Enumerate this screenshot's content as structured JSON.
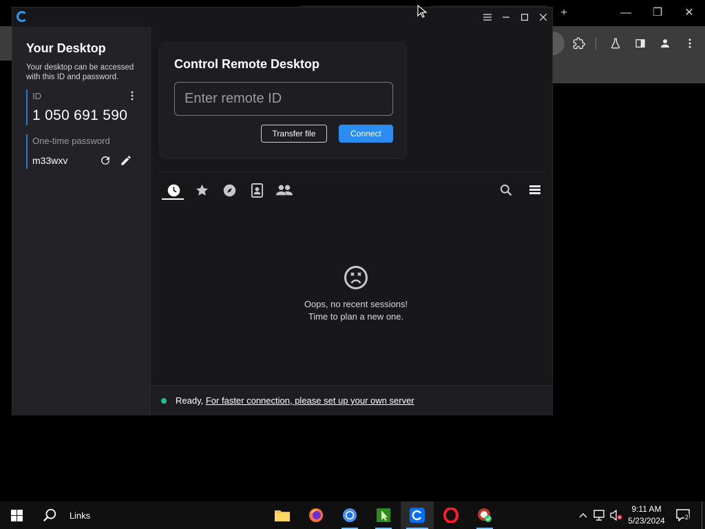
{
  "browser": {
    "new_tab": "+",
    "window_controls": {
      "minimize": "—",
      "restore": "❐",
      "close": "✕"
    }
  },
  "app": {
    "window_controls": {
      "menu": "≡",
      "minimize": "—",
      "maximize": "☐",
      "close": "✕"
    },
    "sidebar": {
      "title": "Your Desktop",
      "description": "Your desktop can be accessed with this ID and password.",
      "id_label": "ID",
      "id_value": "1 050 691 590",
      "password_label": "One-time password",
      "password_value": "m33wxv"
    },
    "control": {
      "title": "Control Remote Desktop",
      "input_placeholder": "Enter remote ID",
      "transfer_label": "Transfer file",
      "connect_label": "Connect"
    },
    "tabs": [
      "recent",
      "favorites",
      "discovered",
      "address-book",
      "group"
    ],
    "empty": {
      "line1": "Oops, no recent sessions!",
      "line2": "Time to plan a new one."
    },
    "status": {
      "state": "Ready,",
      "link": "For faster connection, please set up your own server"
    }
  },
  "taskbar": {
    "search_label": "Links",
    "time": "9:11 AM",
    "date": "5/23/2024",
    "notification_count": "2"
  }
}
